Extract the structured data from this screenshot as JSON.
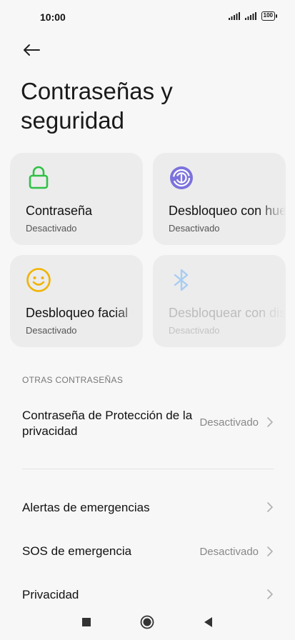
{
  "status_bar": {
    "time": "10:00",
    "battery": "100",
    "icons": [
      "signal-icon",
      "signal-icon",
      "battery-icon"
    ]
  },
  "header": {
    "back_icon": "arrow-left-icon",
    "title": "Contraseñas y seguridad"
  },
  "cards": [
    {
      "title": "Contraseña",
      "status": "Desactivado",
      "icon": "lock-icon",
      "color": "#2fc145",
      "enabled": true
    },
    {
      "title": "Desbloqueo con huella dactilar",
      "status": "Desactivado",
      "icon": "fingerprint-icon",
      "color": "#6e6ee3",
      "enabled": true
    },
    {
      "title": "Desbloqueo facial",
      "status": "Desactivado",
      "icon": "smiley-icon",
      "color": "#f0b400",
      "enabled": true
    },
    {
      "title": "Desbloquear con dispositivo Bluetooth",
      "status": "Desactivado",
      "icon": "bluetooth-icon",
      "color": "#a9cdf2",
      "enabled": false
    }
  ],
  "section": {
    "header": "OTRAS CONTRASEÑAS"
  },
  "rows": [
    {
      "label": "Contraseña de Protección de la privacidad",
      "value": "Desactivado"
    },
    {
      "label": "Alertas de emergencias",
      "value": ""
    },
    {
      "label": "SOS de emergencia",
      "value": "Desactivado"
    },
    {
      "label": "Privacidad",
      "value": ""
    }
  ],
  "nav": {
    "buttons": [
      "recents-square-icon",
      "home-circle-icon",
      "back-triangle-icon"
    ]
  }
}
